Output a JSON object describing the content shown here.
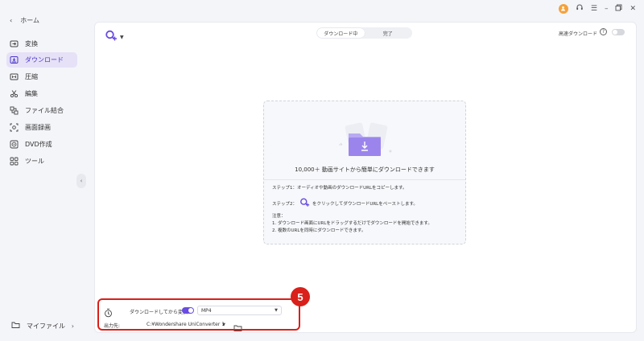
{
  "sidebar": {
    "home_label": "ホーム",
    "items": [
      {
        "label": "変換",
        "icon": "convert-icon"
      },
      {
        "label": "ダウンロード",
        "icon": "download-icon"
      },
      {
        "label": "圧縮",
        "icon": "compress-icon"
      },
      {
        "label": "編集",
        "icon": "scissors-icon"
      },
      {
        "label": "ファイル結合",
        "icon": "merge-icon"
      },
      {
        "label": "画面録画",
        "icon": "screen-record-icon"
      },
      {
        "label": "DVD作成",
        "icon": "dvd-icon"
      },
      {
        "label": "ツール",
        "icon": "tools-icon"
      }
    ],
    "active_index": 1,
    "myfile_label": "マイファイル"
  },
  "header": {
    "tabs": [
      "ダウンロード中",
      "完了"
    ],
    "active_tab": 0,
    "high_speed_label": "高速ダウンロード",
    "high_speed_enabled": false
  },
  "dropzone": {
    "title": "10,000＋ 動画サイトから簡単にダウンロードできます",
    "step1": "ステップ1：オーディオや動画のダウンロードURLをコピーします。",
    "step2_prefix": "ステップ2：",
    "step2_suffix": "をクリックしてダウンロードURLをペーストします。",
    "note_title": "注意：",
    "note1": "1. ダウンロード画面にURLをドラッグするだけでダウンロードを開始できます。",
    "note2": "2. 複数のURLを同時にダウンロードできます。"
  },
  "settings": {
    "convert_after_label": "ダウンロードしてから変換:",
    "convert_after_enabled": true,
    "format_value": "MP4",
    "output_label": "出力先:",
    "output_path": "C:¥Wondershare UniConverter 1"
  },
  "annotation": {
    "step_number": "5"
  },
  "colors": {
    "accent": "#6a4ce0",
    "highlight": "#d9201a",
    "active_bg": "#e6e1f7"
  }
}
